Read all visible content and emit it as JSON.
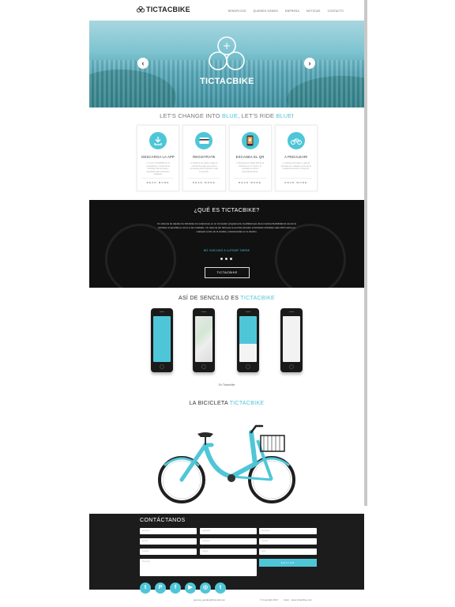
{
  "brand": {
    "name": "TICTACBIKE",
    "accent": "#4fc6d8"
  },
  "nav": [
    "BENEFICIOS",
    "QUIENES SOMOS",
    "EMPRESA",
    "NOTICIAS",
    "CONTACTO"
  ],
  "hero": {
    "title": "TICTACBIKE",
    "prev_icon": "chevron-left-icon",
    "next_icon": "chevron-right-icon"
  },
  "slogan": {
    "pre": "LET'S CHANGE INTO ",
    "blue1": "BLUE",
    "mid": ", LET'S RIDE ",
    "blue2": "BLUE",
    "post": "!"
  },
  "steps": [
    {
      "title": "DESCARGA LA APP",
      "icon": "download-icon",
      "text": "1. Lorem TicTacBike en tu smartphone, encuentra la bicicleta mas cercana y registrate para empezar a pedalear.",
      "more": "READ MORE"
    },
    {
      "title": "REGISTRATE",
      "icon": "card-icon",
      "text": "2. Rellena tus datos y elige el metodo de pago que mas te convenga para empezar a usar el servicio.",
      "more": "READ MORE"
    },
    {
      "title": "ESCANEA EL QR",
      "icon": "phone-qr-icon",
      "text": "3. Escanea el codigo QR de la bicicleta con tu movil y el candado se abrira automaticamente.",
      "more": "READ MORE"
    },
    {
      "title": "A PEDALEAR!",
      "icon": "bike-icon",
      "text": "4. Disfruta del paseo y deja la bicicleta en cualquier punto de la ciudad al terminar tu trayecto.",
      "more": "READ MORE"
    }
  ],
  "about": {
    "title": "¿QUÉ ES TICTACBIKE?",
    "text": "Un sistema de alquiler de bicicletas sin estaciones es un innovador programa de movilidad que da la maxima flexibilidad al uso de la bicicleta compartida en torno a las ciudades. Un sistema tan fácil que te permite acceder a bicicletas ubicadas cada 100 metros en cualquier punto de la ciudad y estacionarlas en tu destino.",
    "tagline": "NO VUELVAS A LLEGAR TARDE",
    "button": "TICTACBIKE"
  },
  "simple": {
    "pre": "ASÍ DE SENCILLO ES ",
    "blue": "TICTACBIKE",
    "caption": "En Tictacbike"
  },
  "bike_section": {
    "pre": "LA BICICLETA ",
    "blue": "TICTACBIKE"
  },
  "contact": {
    "title": "CONTÁCTANOS",
    "fields": [
      "Nombre",
      "Apellidos",
      "Empresa",
      "Email",
      "Telefono",
      "Ciudad",
      "Asunto",
      "Cargo",
      "Web"
    ],
    "message_placeholder": "Mensaje",
    "send": "ENVIAR"
  },
  "social": [
    {
      "icon": "twitter-icon",
      "glyph": "t"
    },
    {
      "icon": "pinterest-icon",
      "glyph": "P"
    },
    {
      "icon": "facebook-icon",
      "glyph": "f"
    },
    {
      "icon": "youtube-icon",
      "glyph": "▶"
    },
    {
      "icon": "instagram-icon",
      "glyph": "◎"
    },
    {
      "icon": "twitter-bird-icon",
      "glyph": "t"
    }
  ],
  "footer": {
    "email": "genova_garden@hotmail.com",
    "copyright": "© Copyright 2017",
    "author": "Autor · www.tictacbike.com"
  }
}
